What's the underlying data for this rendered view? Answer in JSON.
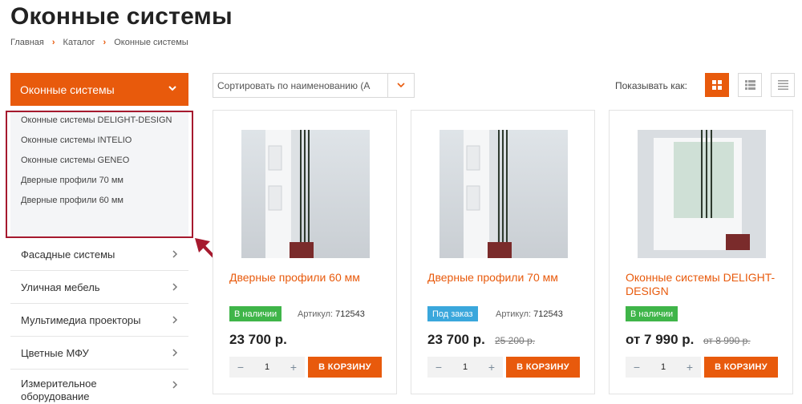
{
  "page": {
    "title": "Оконные системы"
  },
  "breadcrumb": [
    "Главная",
    "Каталог",
    "Оконные системы"
  ],
  "sidebar": {
    "active_label": "Оконные системы",
    "submenu": [
      "Оконные системы DELIGHT-DESIGN",
      "Оконные системы INTELIO",
      "Оконные системы GENEO",
      "Дверные профили 70 мм",
      "Дверные профили 60 мм"
    ],
    "items": [
      "Фасадные системы",
      "Уличная мебель",
      "Мультимедиа проекторы",
      "Цветные МФУ",
      "Измерительное оборудование"
    ]
  },
  "toolbar": {
    "sort_value": "Сортировать по наименованию (А",
    "view_label": "Показывать как:"
  },
  "products": [
    {
      "name": "Дверные профили 60 мм",
      "status": "В наличии",
      "status_color": "#3fb549",
      "sku_label": "Артикул:",
      "sku": "712543",
      "price": "23 700 р.",
      "old_price": "",
      "qty": "1",
      "cart_label": "В КОРЗИНУ"
    },
    {
      "name": "Дверные профили 70 мм",
      "status": "Под заказ",
      "status_color": "#3aa7dc",
      "sku_label": "Артикул:",
      "sku": "712543",
      "price": "23 700 р.",
      "old_price": "25 200 р.",
      "qty": "1",
      "cart_label": "В КОРЗИНУ"
    },
    {
      "name": "Оконные системы DELIGHT-DESIGN",
      "status": "В наличии",
      "status_color": "#3fb549",
      "sku_label": "",
      "sku": "",
      "price": "от 7 990 р.",
      "old_price": "от 8 990 р.",
      "qty": "1",
      "cart_label": "В КОРЗИНУ"
    }
  ],
  "colors": {
    "accent": "#e85a0c",
    "highlight": "#a6192e"
  }
}
